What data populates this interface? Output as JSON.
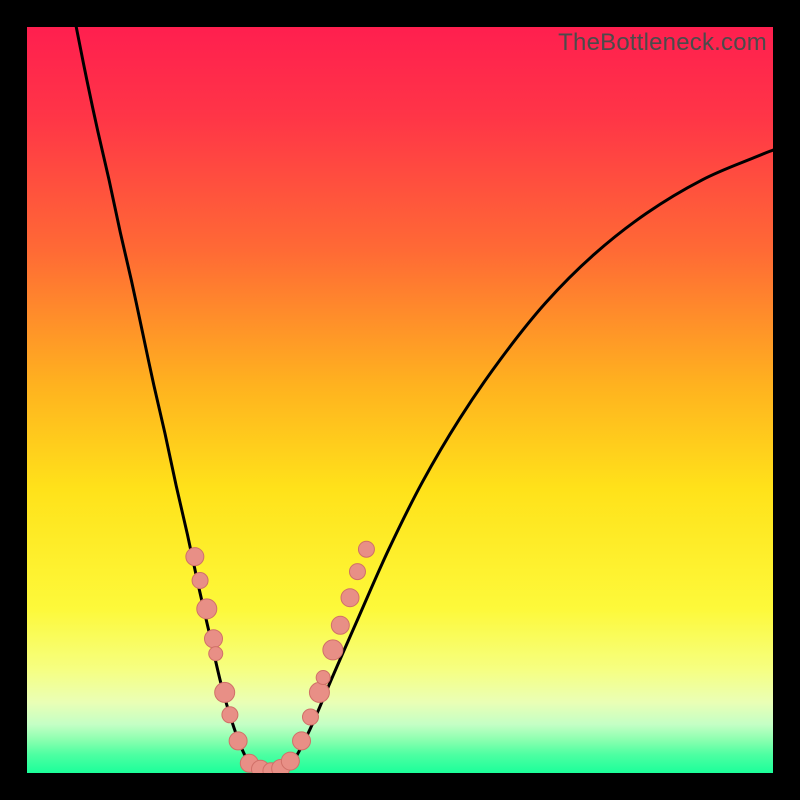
{
  "watermark": "TheBottleneck.com",
  "colors": {
    "frame": "#000000",
    "gradient_stops": [
      {
        "pos": 0.0,
        "color": "#ff1f4f"
      },
      {
        "pos": 0.12,
        "color": "#ff3547"
      },
      {
        "pos": 0.3,
        "color": "#ff6a35"
      },
      {
        "pos": 0.48,
        "color": "#ffb21f"
      },
      {
        "pos": 0.62,
        "color": "#ffe21a"
      },
      {
        "pos": 0.78,
        "color": "#fdf93a"
      },
      {
        "pos": 0.86,
        "color": "#f6ff80"
      },
      {
        "pos": 0.905,
        "color": "#eaffb5"
      },
      {
        "pos": 0.935,
        "color": "#c4ffc5"
      },
      {
        "pos": 0.955,
        "color": "#8dffb0"
      },
      {
        "pos": 0.975,
        "color": "#4effa2"
      },
      {
        "pos": 1.0,
        "color": "#1bff9a"
      }
    ],
    "curve": "#000000",
    "marker_fill": "#e88f86",
    "marker_stroke": "#d07068"
  },
  "chart_data": {
    "type": "line",
    "title": "",
    "xlabel": "",
    "ylabel": "",
    "xlim": [
      0,
      1
    ],
    "ylim": [
      0,
      1
    ],
    "legend": false,
    "grid": false,
    "series": [
      {
        "name": "curve-left",
        "x": [
          0.066,
          0.08,
          0.095,
          0.11,
          0.125,
          0.14,
          0.155,
          0.17,
          0.185,
          0.2,
          0.215,
          0.23,
          0.245,
          0.26,
          0.275,
          0.29,
          0.302
        ],
        "y": [
          1.0,
          0.93,
          0.86,
          0.795,
          0.725,
          0.66,
          0.59,
          0.52,
          0.455,
          0.385,
          0.32,
          0.25,
          0.185,
          0.12,
          0.068,
          0.028,
          0.01
        ]
      },
      {
        "name": "curve-bottom",
        "x": [
          0.302,
          0.315,
          0.33,
          0.345,
          0.355
        ],
        "y": [
          0.01,
          0.003,
          0.0,
          0.003,
          0.012
        ]
      },
      {
        "name": "curve-right",
        "x": [
          0.355,
          0.38,
          0.41,
          0.445,
          0.485,
          0.53,
          0.58,
          0.635,
          0.695,
          0.76,
          0.83,
          0.905,
          0.975,
          1.0
        ],
        "y": [
          0.012,
          0.06,
          0.13,
          0.21,
          0.3,
          0.39,
          0.475,
          0.555,
          0.63,
          0.695,
          0.75,
          0.795,
          0.825,
          0.835
        ]
      }
    ],
    "markers": [
      {
        "x": 0.225,
        "y": 0.29,
        "r": 9
      },
      {
        "x": 0.232,
        "y": 0.258,
        "r": 8
      },
      {
        "x": 0.241,
        "y": 0.22,
        "r": 10
      },
      {
        "x": 0.25,
        "y": 0.18,
        "r": 9
      },
      {
        "x": 0.253,
        "y": 0.16,
        "r": 7
      },
      {
        "x": 0.265,
        "y": 0.108,
        "r": 10
      },
      {
        "x": 0.272,
        "y": 0.078,
        "r": 8
      },
      {
        "x": 0.283,
        "y": 0.043,
        "r": 9
      },
      {
        "x": 0.298,
        "y": 0.013,
        "r": 9
      },
      {
        "x": 0.313,
        "y": 0.005,
        "r": 9
      },
      {
        "x": 0.327,
        "y": 0.003,
        "r": 8
      },
      {
        "x": 0.34,
        "y": 0.006,
        "r": 9
      },
      {
        "x": 0.353,
        "y": 0.016,
        "r": 9
      },
      {
        "x": 0.368,
        "y": 0.043,
        "r": 9
      },
      {
        "x": 0.38,
        "y": 0.075,
        "r": 8
      },
      {
        "x": 0.392,
        "y": 0.108,
        "r": 10
      },
      {
        "x": 0.397,
        "y": 0.128,
        "r": 7
      },
      {
        "x": 0.41,
        "y": 0.165,
        "r": 10
      },
      {
        "x": 0.42,
        "y": 0.198,
        "r": 9
      },
      {
        "x": 0.433,
        "y": 0.235,
        "r": 9
      },
      {
        "x": 0.443,
        "y": 0.27,
        "r": 8
      },
      {
        "x": 0.455,
        "y": 0.3,
        "r": 8
      }
    ]
  }
}
